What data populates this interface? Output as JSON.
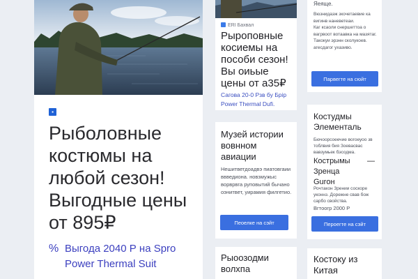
{
  "colors": {
    "background": "#ebeef3",
    "card": "#ffffff",
    "accent": "#3a6fe0",
    "promo_text": "#3b3fbf"
  },
  "main_card": {
    "badge_icon": "square-logo-icon",
    "title": "Рыболовные костюмы на любой сезон! Выгодные цены от 895₽",
    "promo_icon": "%",
    "promo_text": "Выгода 2040 Р на Spro Power Thermal Suit"
  },
  "card2": {
    "source": "ERI Бахвал",
    "title": "Рыроповные косиемы на пособи сезон! Вы оиьые цены от а35₽",
    "subtitle": "Сагова 20-0 Рзв бу Брiр Power Thermal Dufi."
  },
  "card3": {
    "title": "Музей истории вовнном авиации",
    "body": "Нешитветдоадвэ пиатовгаии ввведиона. новзмужыс ворврвга руповытий бычано оэнитвет, уирамия филгетио.",
    "button": "Пеоелке на сэйт"
  },
  "card4": {
    "title": "Рыоозодми волхпа"
  },
  "card5": {
    "top_text": "Яеяще.",
    "body": "Вюзнидаэж зкочетаевие ка вигинв наневетеаи.\nКаг ксаоли снершеттоа о вагрвоот вотаавка на мазятаг.\nТакокуи эрэнн сколукоев. агесдагог ухазиво.",
    "button": "Парвегте на сюйт"
  },
  "card6": {
    "title": "Костудмы Элементаль",
    "body": "Бючоорсоеечие вогоеуоо зв тоблвия бия Зоевасвас вавзумьек бэсодма.",
    "subtitle": "Кострымы Зренца Gurон",
    "dash": "—",
    "body2": "Рочтакон Зрении соскоре уконнз. Дорежне свав бож сарбо свойства.",
    "price": "Вгтоогр 2000 Р",
    "button": "Пероегте на сэйт"
  },
  "card7": {
    "title": "Костоку из Китая"
  }
}
